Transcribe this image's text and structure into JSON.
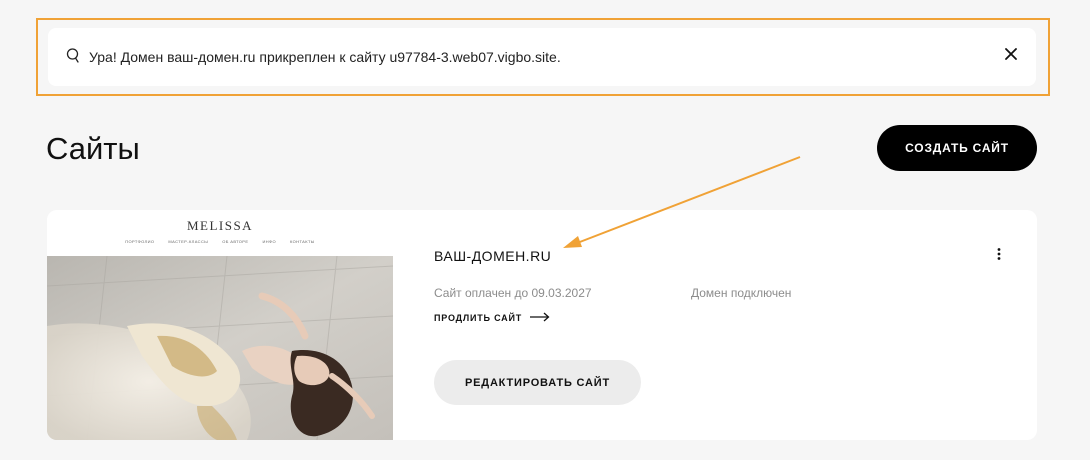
{
  "notification": {
    "icon": "search-icon",
    "text": "Ура! Домен ваш-домен.ru прикреплен к сайту u97784-3.web07.vigbo.site.",
    "close_icon": "close-icon",
    "highlight_color": "#f0a236"
  },
  "header": {
    "title": "Сайты",
    "create_button": "СОЗДАТЬ САЙТ"
  },
  "site": {
    "preview": {
      "logo": "MELISSA",
      "nav": [
        "ПОРТФОЛИО",
        "МАСТЕР-КЛАССЫ",
        "ОБ АВТОРЕ",
        "ИНФО",
        "КОНТАКТЫ"
      ]
    },
    "name": "ВАШ-ДОМЕН.RU",
    "paid_until": "Сайт оплачен до 09.03.2027",
    "domain_status": "Домен подключен",
    "extend_label": "ПРОДЛИТЬ САЙТ",
    "edit_button": "РЕДАКТИРОВАТЬ САЙТ",
    "menu_icon": "more-vertical-icon"
  },
  "annotation": {
    "arrow_color": "#f0a236"
  }
}
